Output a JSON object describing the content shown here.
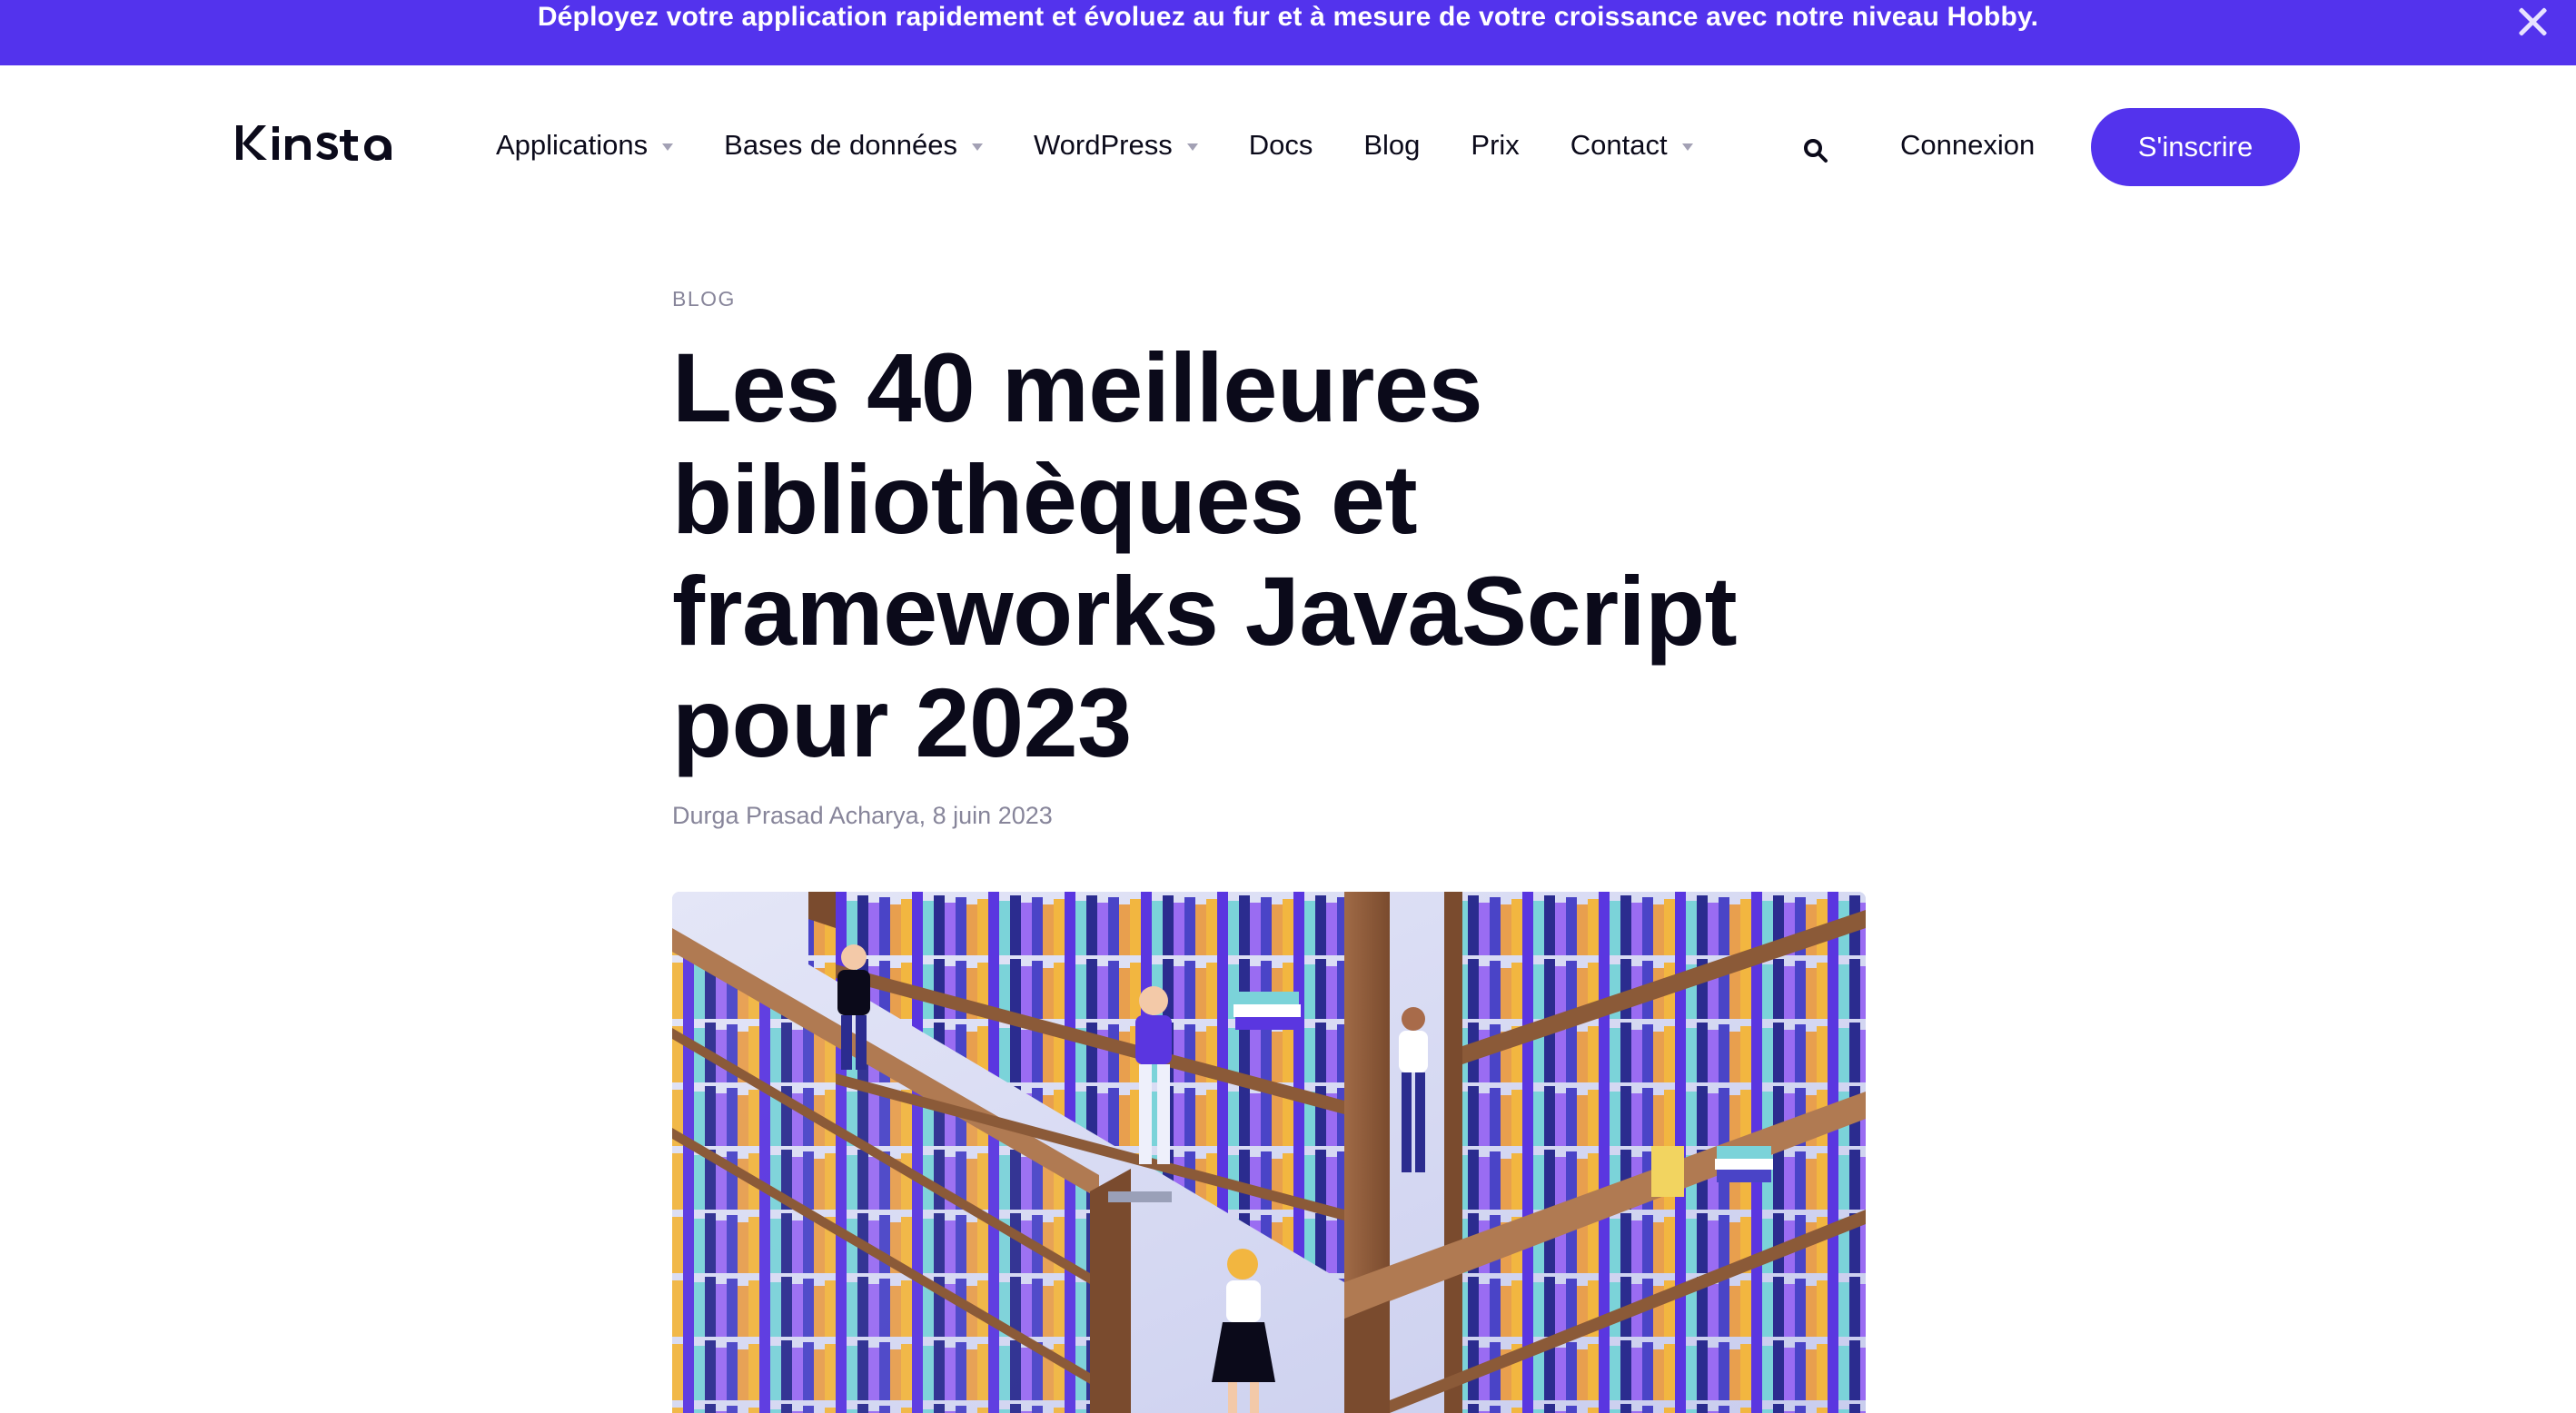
{
  "promo": {
    "text": "Déployez votre application rapidement et évoluez au fur et à mesure de votre croissance avec notre niveau Hobby."
  },
  "nav": {
    "logo_text": "KINSTa",
    "items": [
      {
        "label": "Applications",
        "has_dropdown": true
      },
      {
        "label": "Bases de données",
        "has_dropdown": true
      },
      {
        "label": "WordPress",
        "has_dropdown": true
      },
      {
        "label": "Docs",
        "has_dropdown": false
      },
      {
        "label": "Blog",
        "has_dropdown": false
      },
      {
        "label": "Prix",
        "has_dropdown": false
      },
      {
        "label": "Contact",
        "has_dropdown": true
      }
    ],
    "login": "Connexion",
    "signup": "S'inscrire"
  },
  "article": {
    "category": "Blog",
    "title": "Les 40 meilleures bibliothèques et frameworks JavaScript pour 2023",
    "meta": "Durga Prasad Acharya, 8 juin 2023"
  },
  "colors": {
    "brand": "#5333ed",
    "text": "#0b0a1a",
    "muted": "#87859a"
  },
  "icons": {
    "search": "search-icon",
    "close": "close-icon",
    "dropdown": "chevron-down-icon"
  }
}
